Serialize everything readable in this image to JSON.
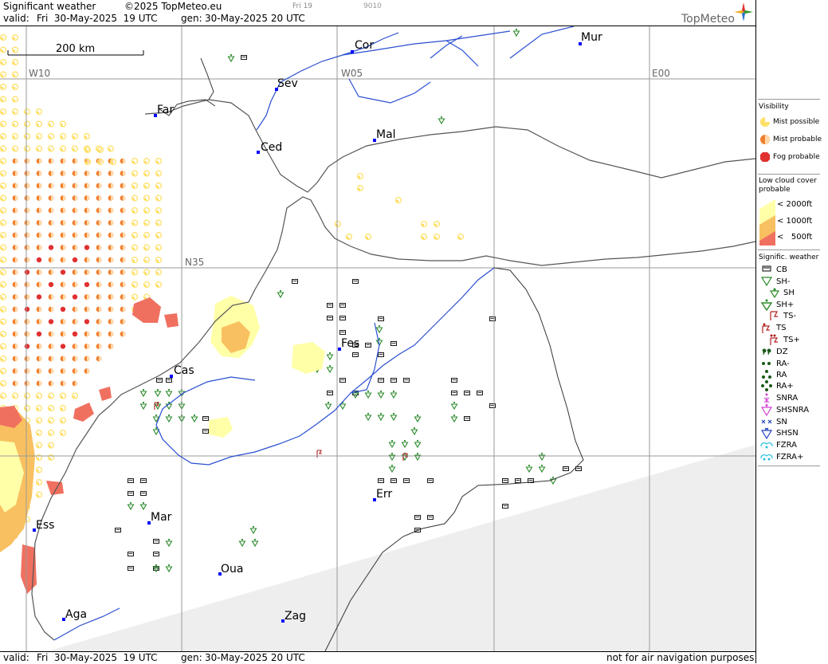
{
  "header": {
    "title": "Significant weather",
    "copyright": "©2025 TopMeteo.eu",
    "frame_day": "Fri 19",
    "frame_code": "9010",
    "valid_label": "valid:",
    "valid_value": "Fri  30-May-2025  19 UTC",
    "gen_label": "gen:",
    "gen_value": "30-May-2025 20 UTC",
    "logo": "TopMeteo"
  },
  "footer": {
    "valid_label": "valid:",
    "valid_value": "Fri  30-May-2025  19 UTC",
    "gen_label": "gen:",
    "gen_value": "30-May-2025 20 UTC",
    "disclaimer": "not for air navigation purposes"
  },
  "map": {
    "scale_label": "200 km",
    "grid_labels": {
      "w10": "W10",
      "w05": "W05",
      "e00": "E00",
      "n35": "N35"
    },
    "cities": [
      {
        "id": "cor",
        "name": "Cor"
      },
      {
        "id": "mur",
        "name": "Mur"
      },
      {
        "id": "sev",
        "name": "Sev"
      },
      {
        "id": "far",
        "name": "Far"
      },
      {
        "id": "mal",
        "name": "Mal"
      },
      {
        "id": "ced",
        "name": "Ced"
      },
      {
        "id": "fes",
        "name": "Fes"
      },
      {
        "id": "cas",
        "name": "Cas"
      },
      {
        "id": "err",
        "name": "Err"
      },
      {
        "id": "mar",
        "name": "Mar"
      },
      {
        "id": "ess",
        "name": "Ess"
      },
      {
        "id": "oua",
        "name": "Oua"
      },
      {
        "id": "aga",
        "name": "Aga"
      },
      {
        "id": "zag",
        "name": "Zag"
      }
    ]
  },
  "legend": {
    "visibility_title": "Visibility",
    "visibility": [
      "Mist possible",
      "Mist probable",
      "Fog probable"
    ],
    "lowcloud_title_1": "Low cloud cover",
    "lowcloud_title_2": "probable",
    "lowcloud": [
      "< 2000ft",
      "< 1000ft",
      "<   500ft"
    ],
    "sigwx_title": "Signific. weather",
    "sigwx": [
      "CB",
      "SH-",
      "SH",
      "SH+",
      "TS-",
      "TS",
      "TS+",
      "DZ",
      "RA-",
      "RA",
      "RA+",
      "SNRA",
      "SHSNRA",
      "SN",
      "SHSN",
      "FZRA",
      "FZRA+"
    ]
  },
  "colors": {
    "coast": "#555555",
    "border": "#333333",
    "river": "#2a4fd0",
    "city": "#0000ff",
    "mist_possible": "#ffe066",
    "mist_probable": "#f08030",
    "fog": "#e03030",
    "lowcloud_2000": "#ffffa8",
    "lowcloud_1000": "#f8c060",
    "lowcloud_500": "#f07060",
    "shower": "#2a8a2a",
    "thunder": "#b02020",
    "grid": "#9a9a9a",
    "out_of_area": "#eeeeee"
  }
}
